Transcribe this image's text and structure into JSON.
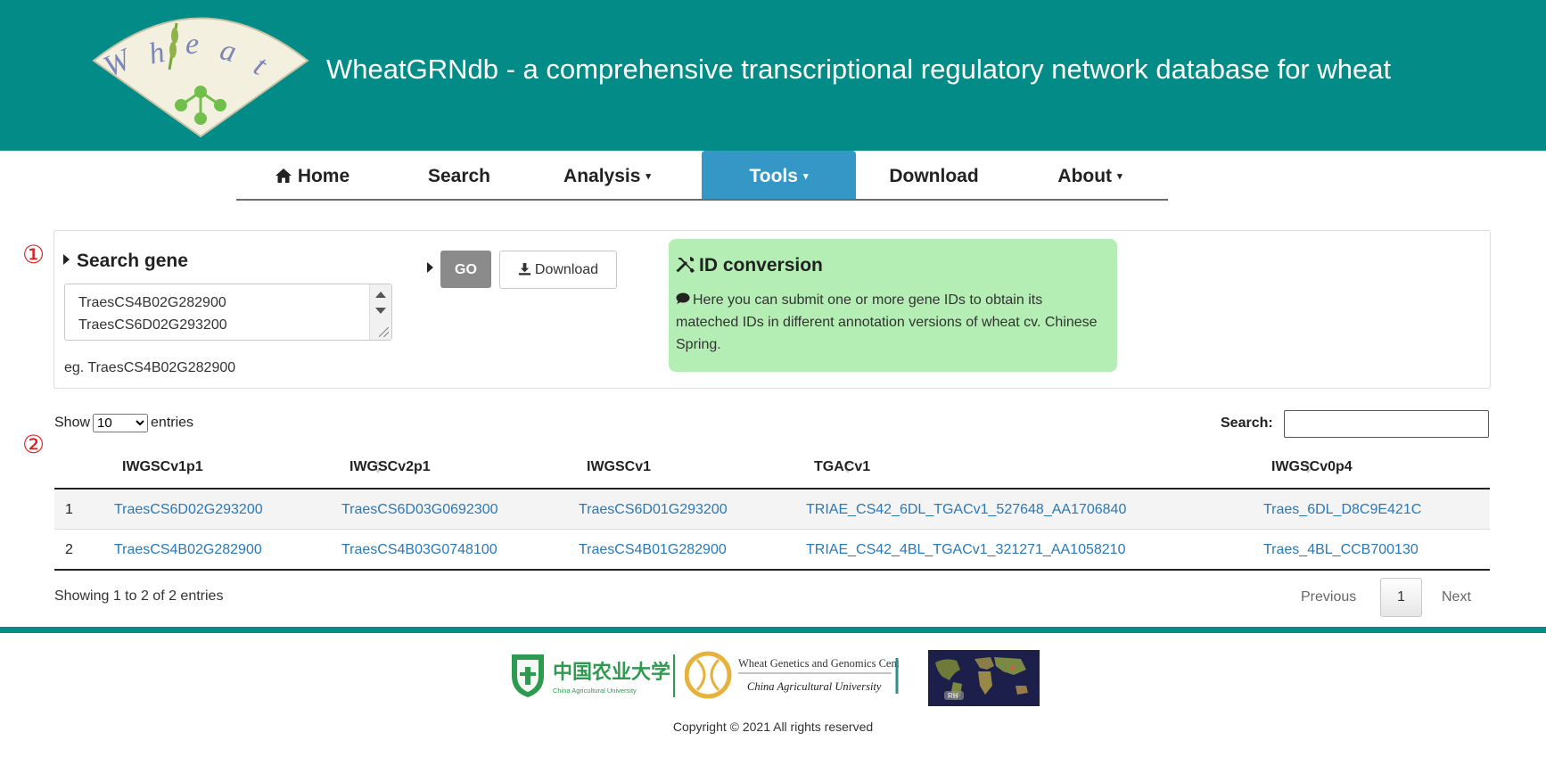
{
  "header": {
    "logo_text": "Wheat",
    "title": "WheatGRNdb - a comprehensive transcriptional regulatory network database for wheat",
    "bg_color": "#038b87"
  },
  "nav": {
    "items": [
      {
        "label": "Home",
        "icon": "home-icon"
      },
      {
        "label": "Search"
      },
      {
        "label": "Analysis",
        "dropdown": true
      },
      {
        "label": "Tools",
        "dropdown": true,
        "active": true
      },
      {
        "label": "Download"
      },
      {
        "label": "About",
        "dropdown": true
      }
    ],
    "active_color": "#3497c5"
  },
  "markers": [
    "①",
    "②"
  ],
  "search_gene": {
    "title": "Search gene",
    "textarea_lines": [
      "TraesCS4B02G282900",
      "TraesCS6D02G293200"
    ],
    "example": "eg. TraesCS4B02G282900",
    "go_label": "GO",
    "download_label": "Download"
  },
  "id_conversion": {
    "title": "ID conversion",
    "description": "Here you can submit one or more gene IDs to obtain its mateched IDs in different annotation versions of wheat cv. Chinese Spring.",
    "bg_color": "#b4eeb4"
  },
  "table": {
    "length_prefix": "Show",
    "length_value": "10",
    "length_suffix": "entries",
    "search_label": "Search:",
    "search_value": "",
    "columns": [
      "",
      "IWGSCv1p1",
      "IWGSCv2p1",
      "IWGSCv1",
      "TGACv1",
      "IWGSCv0p4"
    ],
    "rows": [
      [
        "1",
        "TraesCS6D02G293200",
        "TraesCS6D03G0692300",
        "TraesCS6D01G293200",
        "TRIAE_CS42_6DL_TGACv1_527648_AA1706840",
        "Traes_6DL_D8C9E421C"
      ],
      [
        "2",
        "TraesCS4B02G282900",
        "TraesCS4B03G0748100",
        "TraesCS4B01G282900",
        "TRIAE_CS42_4BL_TGACv1_321271_AA1058210",
        "Traes_4BL_CCB700130"
      ]
    ],
    "info": "Showing 1 to 2 of 2 entries",
    "pagination": {
      "previous": "Previous",
      "current": "1",
      "next": "Next"
    },
    "link_color": "#2a78b8"
  },
  "footer": {
    "cau_chinese": "中国农业大学",
    "cau_english": "China Agricultural University",
    "wggc_title": "Wheat Genetics and Genomics Center",
    "wggc_subtitle": "China Agricultural University",
    "map_label": "RH",
    "copyright": "Copyright © 2021 All rights reserved"
  }
}
